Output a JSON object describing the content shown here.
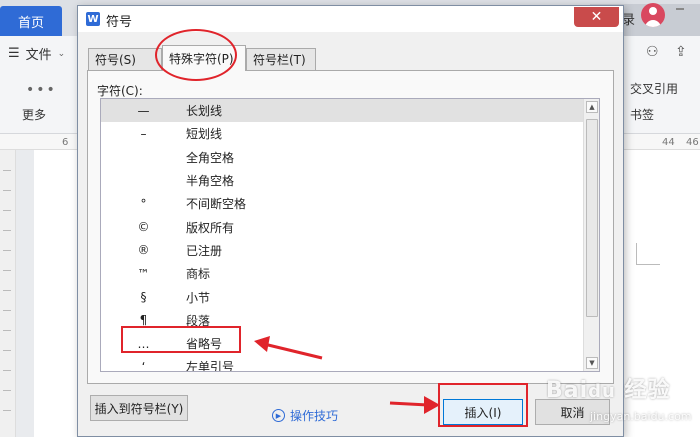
{
  "app": {
    "home_tab": "首页",
    "right_tab_text": "录",
    "file_menu": "文件",
    "more_label": "更多",
    "right_tools": [
      "交叉引用",
      "书签"
    ],
    "ruler_marks": [
      "6",
      "44",
      "46"
    ]
  },
  "dialog": {
    "title": "符号",
    "close_glyph": "✕",
    "tabs": [
      "符号(S)",
      "特殊字符(P)",
      "符号栏(T)"
    ],
    "active_tab": "特殊字符(P)",
    "characters_label": "字符(C):",
    "rows": [
      {
        "symbol": "—",
        "name": "长划线"
      },
      {
        "symbol": "–",
        "name": "短划线"
      },
      {
        "symbol": "",
        "name": "全角空格"
      },
      {
        "symbol": "",
        "name": "半角空格"
      },
      {
        "symbol": "°",
        "name": "不间断空格"
      },
      {
        "symbol": "©",
        "name": "版权所有"
      },
      {
        "symbol": "®",
        "name": "已注册"
      },
      {
        "symbol": "™",
        "name": "商标"
      },
      {
        "symbol": "§",
        "name": "小节"
      },
      {
        "symbol": "¶",
        "name": "段落"
      },
      {
        "symbol": "…",
        "name": "省略号"
      },
      {
        "symbol": "‘",
        "name": "左单引号"
      }
    ],
    "selected_row_index": 0,
    "buttons": {
      "insert_to_toolbar": "插入到符号栏(Y)",
      "tips": "操作技巧",
      "insert": "插入(I)",
      "cancel": "取消"
    }
  },
  "colors": {
    "annotation_red": "#e0242b",
    "accent_blue": "#2f6bd6"
  }
}
